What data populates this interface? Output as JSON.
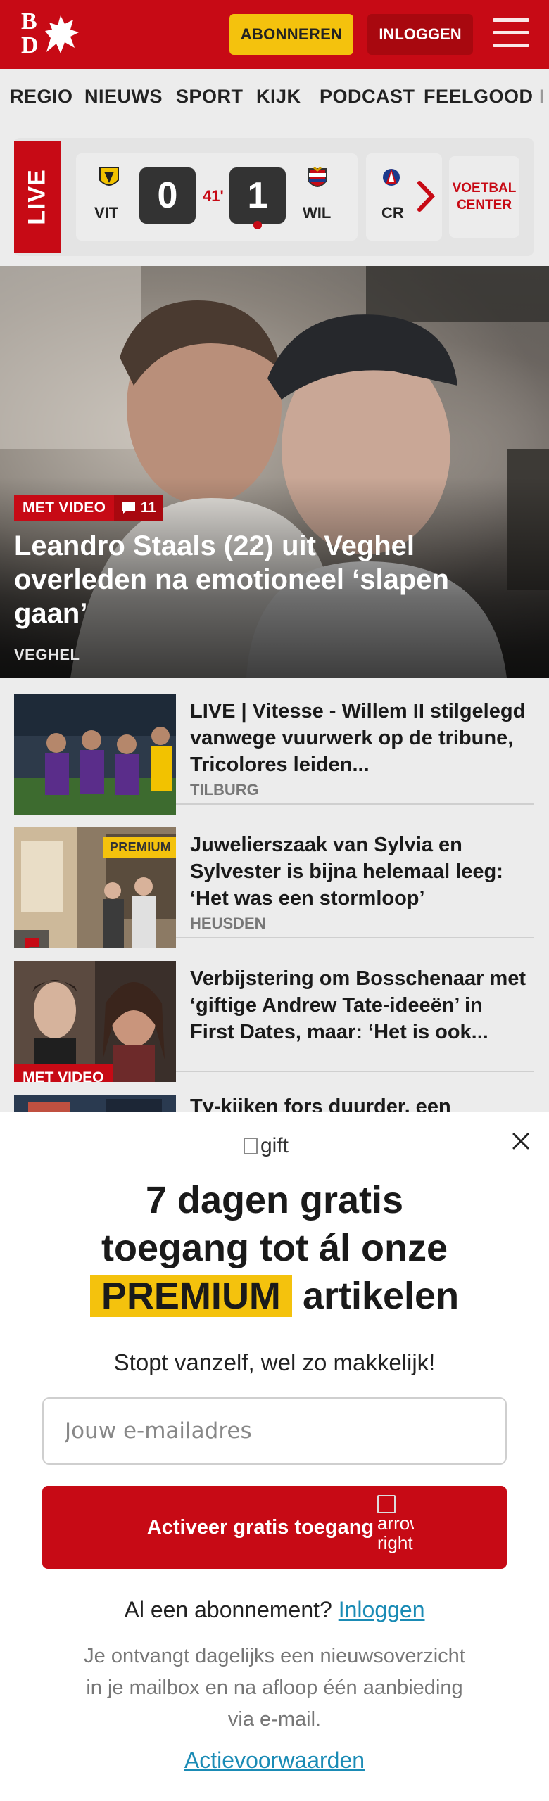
{
  "header": {
    "logo_text_top": "B",
    "logo_text_bottom": "D",
    "subscribe_label": "ABONNEREN",
    "login_label": "INLOGGEN"
  },
  "nav": {
    "items": [
      "REGIO",
      "NIEUWS",
      "SPORT",
      "KIJK",
      "PODCAST",
      "FEELGOOD",
      "I"
    ]
  },
  "live": {
    "label": "LIVE",
    "home_team": "VIT",
    "away_team": "WIL",
    "home_score": "0",
    "away_score": "1",
    "minute": "41'",
    "next_team": "CR",
    "voetbal_center_label": "VOETBAL CENTER"
  },
  "hero": {
    "video_tag": "MET VIDEO",
    "comment_count": "11",
    "title": "Leandro Staals (22) uit Veghel overleden na emotioneel ‘slapen gaan’",
    "location": "VEGHEL"
  },
  "articles": [
    {
      "title": "LIVE | Vitesse - Willem II stilgelegd vanwege vuurwerk op de tribune, Tricolores leiden...",
      "location": "TILBURG",
      "badge": ""
    },
    {
      "title": "Juwelierszaak van Sylvia en Sylvester is bijna helemaal leeg: ‘Het was een stormloop’",
      "location": "HEUSDEN",
      "badge": "PREMIUM"
    },
    {
      "title": "Verbijstering om Bosschenaar met ‘giftige Andrew Tate-ideeën’ in First Dates, maar: ‘Het is ook...",
      "location": "",
      "badge": "MET VIDEO"
    },
    {
      "title": "Tv-kijken fors duurder, een",
      "location": "",
      "badge": ""
    }
  ],
  "modal": {
    "gift_alt": "gift",
    "title_line1": "7 dagen gratis",
    "title_line2": "toegang tot ál onze",
    "title_highlight": "PREMIUM",
    "title_line3_rest": "artikelen",
    "subtitle": "Stopt vanzelf, wel zo makkelijk!",
    "email_placeholder": "Jouw e-mailadres",
    "cta_label": "Activeer gratis toegang",
    "cta_arrow_alt": "arrow right",
    "already_text": "Al een abonnement?",
    "already_link": "Inloggen",
    "info_text": "Je ontvangt dagelijks een nieuwsoverzicht in je mailbox en na afloop één aanbieding via e-mail.",
    "terms_link": "Actievoorwaarden"
  },
  "colors": {
    "brand_red": "#c70a15",
    "premium_yellow": "#f4c20d",
    "link_blue": "#1a8bb5"
  }
}
